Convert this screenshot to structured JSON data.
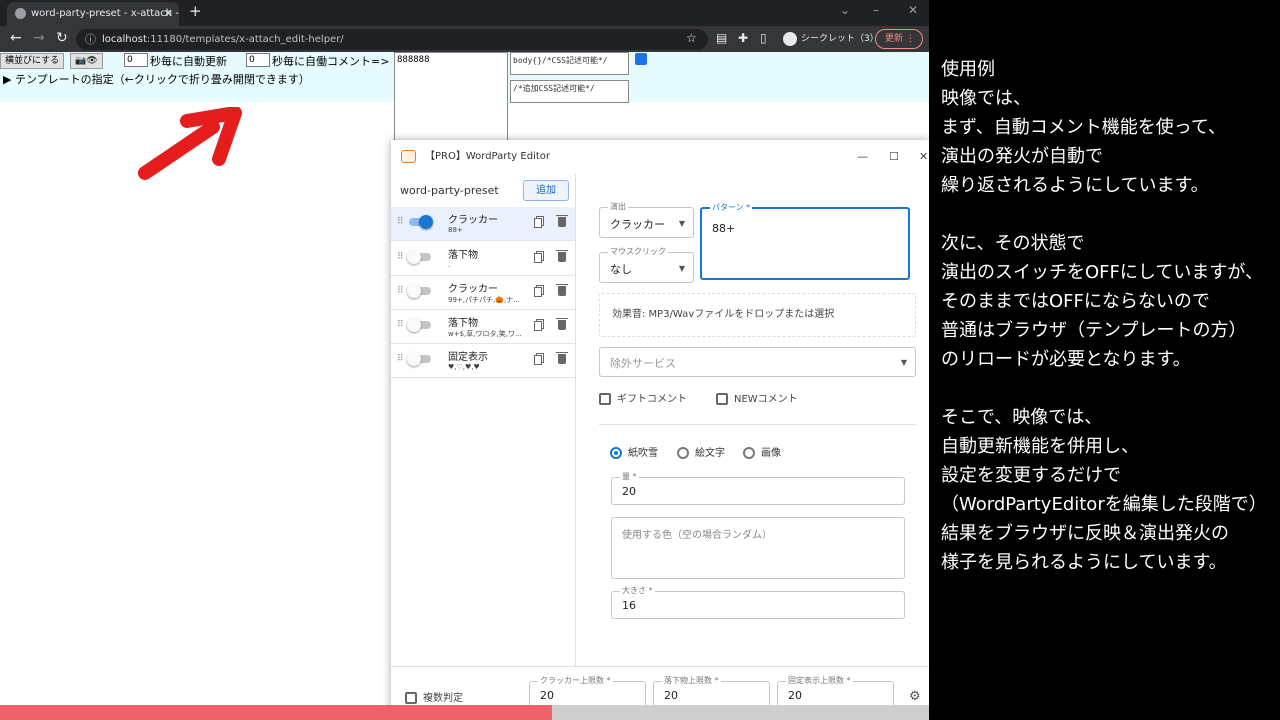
{
  "browser": {
    "tab_title": "word-party-preset - x-attach - e",
    "new_tab": "+",
    "url_host": "localhost",
    "url_rest": ":11180/templates/x-attach_edit-helper/",
    "incognito_label": "シークレット（3）",
    "update_label": "更新",
    "window_controls": [
      "⌄",
      "–",
      "❐",
      "✕"
    ]
  },
  "page": {
    "align_button": "横並びにする",
    "toggle_button": "📷👁",
    "auto_refresh_value": "0",
    "auto_refresh_label": "秒毎に自動更新",
    "auto_comment_value": "0",
    "auto_comment_label": "秒毎に自働コメント=>",
    "comment_text": "888888",
    "template_toggle": "▶ テンプレートの指定（←クリックで折り畳み開閉できます）",
    "css_textarea_1": "body{}/*CSS記述可能*/",
    "css_textarea_2": "/*追加CSS記述可能*/"
  },
  "editor": {
    "title": "【PRO】WordParty Editor",
    "preset_name": "word-party-preset",
    "add_button": "追加",
    "items": [
      {
        "name": "クラッカー",
        "sub": "88+",
        "on": true
      },
      {
        "name": "落下物",
        "sub": ".",
        "on": false
      },
      {
        "name": "クラッカー",
        "sub": "99+,パチパチ,🎃,ナ...",
        "on": false
      },
      {
        "name": "落下物",
        "sub": "w+$,草,ワロタ,笑,ワ...",
        "on": false
      },
      {
        "name": "固定表示",
        "sub": "♥,♡,♥,♥",
        "on": false
      }
    ],
    "effect_label": "演出",
    "effect_value": "クラッカー",
    "pattern_label": "パターン *",
    "pattern_value": "88+",
    "mouse_label": "マウスクリック",
    "mouse_value": "なし",
    "sound_drop": "効果音: MP3/Wavファイルをドロップまたは選択",
    "exclude_service": "除外サービス",
    "gift_comment": "ギフトコメント",
    "new_comment": "NEWコメント",
    "radio_options": [
      "紙吹雪",
      "絵文字",
      "画像"
    ],
    "amount_label": "量 *",
    "amount_value": "20",
    "color_placeholder": "使用する色（空の場合ランダム）",
    "size_label": "大きさ *",
    "size_value": "16",
    "multi_judge": "複数判定",
    "limits": [
      {
        "label": "クラッカー上限数 *",
        "value": "20"
      },
      {
        "label": "落下物上限数 *",
        "value": "20"
      },
      {
        "label": "固定表示上限数 *",
        "value": "20"
      }
    ]
  },
  "video_progress": 0.594,
  "narration": [
    "使用例",
    "映像では、",
    "まず、自動コメント機能を使って、",
    "演出の発火が自動で",
    "繰り返されるようにしています。",
    "",
    "次に、その状態で",
    "演出のスイッチをOFFにしていますが、",
    "そのままではOFFにならないので",
    "普通はブラウザ（テンプレートの方）",
    "のリロードが必要となります。",
    "",
    "そこで、映像では、",
    "自動更新機能を併用し、",
    "設定を変更するだけで",
    "（WordPartyEditorを編集した段階で）",
    "結果をブラウザに反映＆演出発火の",
    "様子を見られるようにしています。"
  ],
  "colors": {
    "accent": "#1976d2",
    "progress": "#f0626a",
    "update": "#f28b82"
  }
}
